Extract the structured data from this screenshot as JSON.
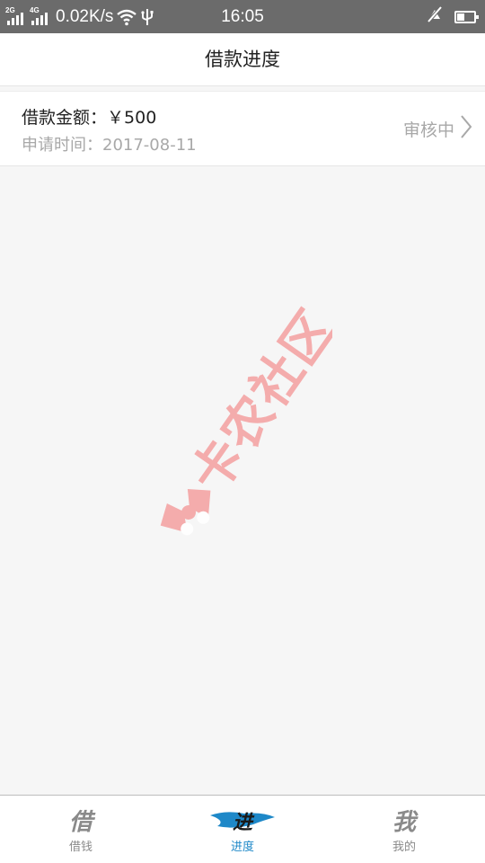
{
  "status_bar": {
    "sim1_tag": "2G",
    "sim2_tag": "4G",
    "net_speed": "0.02K/s",
    "time": "16:05",
    "battery_level": 0.45,
    "icons": [
      "signal-icon",
      "wifi-icon",
      "usb-icon",
      "mute-icon",
      "battery-icon"
    ]
  },
  "header": {
    "title": "借款进度"
  },
  "loan": {
    "amount_label": "借款金额：",
    "amount_value": "￥500",
    "date_label": "申请时间：",
    "date_value": "2017-08-11",
    "status": "审核中"
  },
  "watermark": {
    "text": "卡农社区",
    "color": "#f4a5a5"
  },
  "tabs": [
    {
      "label": "借钱",
      "icon_glyph": "借",
      "icon": "borrow-tab-icon",
      "active": false
    },
    {
      "label": "进度",
      "icon_glyph": "进",
      "icon": "progress-tab-icon",
      "active": true
    },
    {
      "label": "我的",
      "icon_glyph": "我",
      "icon": "mine-tab-icon",
      "active": false
    }
  ],
  "colors": {
    "status_bar_bg": "#6b6b6b",
    "accent": "#1e88c8",
    "muted_text": "#a8a8a8",
    "primary_text": "#222222"
  }
}
